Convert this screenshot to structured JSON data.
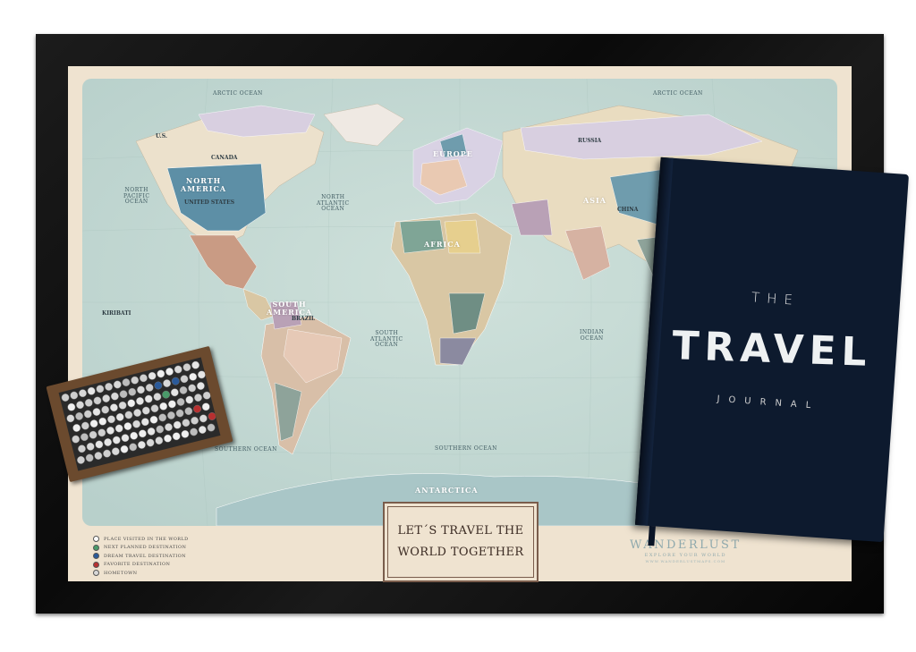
{
  "map": {
    "oceans": {
      "arctic_left": "ARCTIC OCEAN",
      "arctic_right": "ARCTIC OCEAN",
      "north_pacific": "NORTH\nPACIFIC\nOCEAN",
      "north_atlantic": "NORTH\nATLANTIC\nOCEAN",
      "south_atlantic": "SOUTH\nATLANTIC\nOCEAN",
      "indian": "INDIAN\nOCEAN",
      "southern_left": "SOUTHERN OCEAN",
      "southern_mid": "SOUTHERN OCEAN"
    },
    "continents": {
      "north_america": "NORTH\nAMERICA",
      "south_america": "SOUTH\nAMERICA",
      "europe": "EUROPE",
      "africa": "AFRICA",
      "asia": "ASIA",
      "antarctica": "ANTARCTICA"
    },
    "countries": {
      "russia": "RUSSIA",
      "canada": "CANADA",
      "united_states": "UNITED STATES",
      "brazil": "BRAZIL",
      "china": "CHINA",
      "kiribati": "KIRIBATI",
      "us": "U.S."
    }
  },
  "title_box": {
    "line1": "LET´S TRAVEL THE",
    "line2": "WORLD TOGETHER"
  },
  "legend": [
    {
      "label": "PLACE VISITED IN THE WORLD",
      "color": "#ffffff"
    },
    {
      "label": "NEXT PLANNED DESTINATION",
      "color": "#4a9a6a"
    },
    {
      "label": "DREAM TRAVEL DESTINATION",
      "color": "#2a5a9a"
    },
    {
      "label": "FAVORITE DESTINATION",
      "color": "#b83030"
    },
    {
      "label": "HOMETOWN",
      "color": "#d8d8d8"
    }
  ],
  "brand": {
    "name": "WANDERLUST",
    "tagline": "EXPLORE YOUR WORLD",
    "url": "WWW.WANDERLUSTMAPS.COM"
  },
  "journal": {
    "the": "THE",
    "travel": "TRAVEL",
    "journal": "JOURNAL"
  },
  "colors": {
    "frame": "#111111",
    "mat": "#efe3d0",
    "ocean": "#c9dcd6",
    "journal_cover": "#0d1a2e"
  }
}
